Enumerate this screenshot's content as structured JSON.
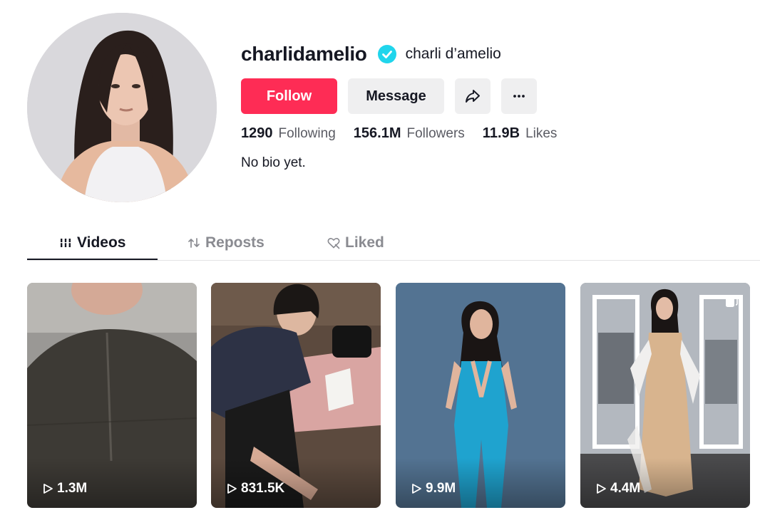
{
  "profile": {
    "username": "charlidamelio",
    "display_name": "charli d’amelio",
    "verified": true,
    "bio": "No bio yet."
  },
  "actions": {
    "follow_label": "Follow",
    "message_label": "Message",
    "share_icon": "share-icon",
    "more_icon": "more-icon",
    "more_label": "···"
  },
  "stats": [
    {
      "value": "1290",
      "label": "Following"
    },
    {
      "value": "156.1M",
      "label": "Followers"
    },
    {
      "value": "11.9B",
      "label": "Likes"
    }
  ],
  "tabs": [
    {
      "label": "Videos",
      "icon": "grid-lines-icon",
      "active": true
    },
    {
      "label": "Reposts",
      "icon": "repost-icon",
      "active": false
    },
    {
      "label": "Liked",
      "icon": "heart-slash-icon",
      "active": false
    }
  ],
  "videos": [
    {
      "views": "1.3M",
      "multi": false
    },
    {
      "views": "831.5K",
      "multi": false
    },
    {
      "views": "9.9M",
      "multi": false
    },
    {
      "views": "4.4M",
      "multi": true
    }
  ],
  "colors": {
    "accent": "#fe2c55",
    "verified": "#20d5ec",
    "text": "#161823",
    "muted": "#5a5b63"
  }
}
